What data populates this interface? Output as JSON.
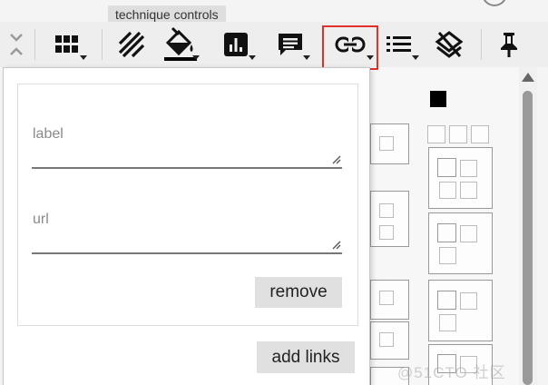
{
  "tooltip": "technique controls",
  "toolbar": {
    "buttons": [
      {
        "name": "collapse-expand",
        "icon": "collapse-arrows-icon"
      },
      {
        "name": "layout",
        "icon": "grid-icon"
      },
      {
        "name": "show-hide-disabled",
        "icon": "hatch-pattern-icon"
      },
      {
        "name": "background-color",
        "icon": "paint-bucket-icon"
      },
      {
        "name": "scoring",
        "icon": "bar-chart-icon"
      },
      {
        "name": "comment",
        "icon": "comment-icon"
      },
      {
        "name": "links",
        "icon": "link-icon",
        "highlighted": true
      },
      {
        "name": "metadata",
        "icon": "list-icon"
      },
      {
        "name": "clear-annotations",
        "icon": "layers-clear-icon"
      },
      {
        "name": "pin",
        "icon": "pin-icon"
      }
    ]
  },
  "links_panel": {
    "label_field": {
      "label": "label",
      "value": ""
    },
    "url_field": {
      "label": "url",
      "value": ""
    },
    "remove_button": "remove",
    "add_links_button": "add links"
  },
  "watermark": "@51CTO 社区",
  "colors": {
    "highlight": "#e0302a",
    "button": "#e0e0e0"
  }
}
